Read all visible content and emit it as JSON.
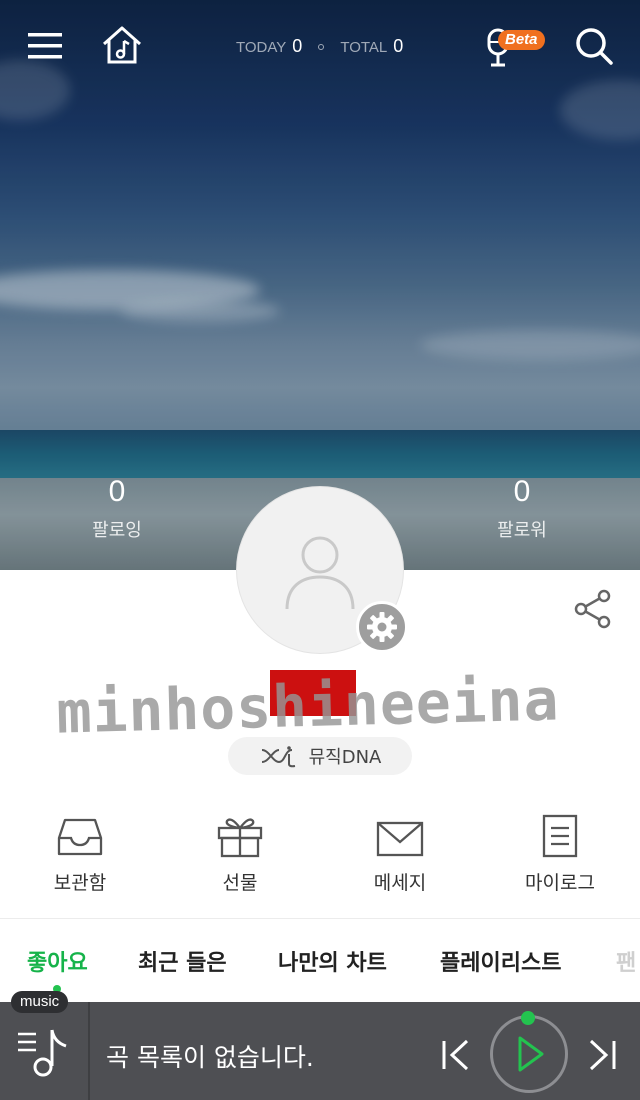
{
  "header": {
    "today_label": "TODAY",
    "today_count": "0",
    "total_label": "TOTAL",
    "total_count": "0",
    "beta_badge": "Beta",
    "icons": [
      "menu-icon",
      "home-music-icon",
      "microphone-icon",
      "search-icon"
    ]
  },
  "profile": {
    "following_count": "0",
    "following_label": "팔로잉",
    "followers_count": "0",
    "followers_label": "팔로워",
    "handwritten_overlay": "minhoshineeina",
    "music_dna_label": "뮤직DNA",
    "name_redacted_color": "#cc1010"
  },
  "quick_menu": [
    {
      "label": "보관함",
      "icon": "inbox-tray-icon"
    },
    {
      "label": "선물",
      "icon": "gift-icon"
    },
    {
      "label": "메세지",
      "icon": "envelope-icon"
    },
    {
      "label": "마이로그",
      "icon": "document-icon"
    }
  ],
  "tabs": [
    {
      "label": "좋아요",
      "active": true
    },
    {
      "label": "최근 들은",
      "active": false
    },
    {
      "label": "나만의 차트",
      "active": false
    },
    {
      "label": "플레이리스트",
      "active": false
    },
    {
      "label": "팬",
      "active": false
    }
  ],
  "player": {
    "badge": "music",
    "status_text": "곡 목록이 없습니다.",
    "icons": [
      "playlist-icon",
      "previous-icon",
      "play-icon",
      "next-icon"
    ]
  },
  "colors": {
    "accent_green": "#16b34a",
    "beta_orange": "#f0701f",
    "player_bg": "#4e4f53"
  }
}
